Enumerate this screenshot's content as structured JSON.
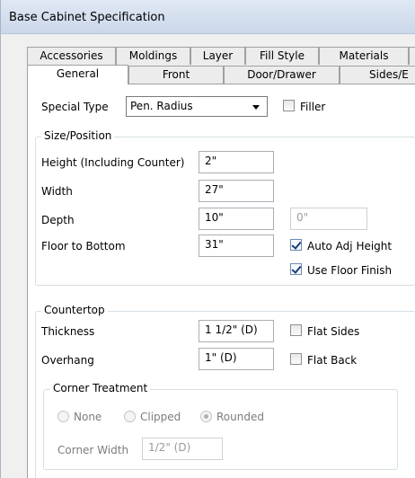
{
  "window": {
    "title": "Base Cabinet Specification"
  },
  "tabs_back": [
    "Accessories",
    "Moldings",
    "Layer",
    "Fill Style",
    "Materials"
  ],
  "tabs_front": [
    "General",
    "Front",
    "Door/Drawer",
    "Sides/E"
  ],
  "general": {
    "special_type_label": "Special Type",
    "special_type_value": "Pen. Radius",
    "filler_label": "Filler",
    "filler_checked": false
  },
  "size_position": {
    "group_title": "Size/Position",
    "height_label": "Height (Including Counter)",
    "height_value": "2\"",
    "width_label": "Width",
    "width_value": "27\"",
    "depth_label": "Depth",
    "depth_value": "10\"",
    "depth_secondary_value": "0\"",
    "floor_label": "Floor to Bottom",
    "floor_value": "31\"",
    "auto_adj_label": "Auto Adj Height",
    "auto_adj_checked": true,
    "use_floor_label": "Use Floor Finish",
    "use_floor_checked": true
  },
  "countertop": {
    "group_title": "Countertop",
    "thickness_label": "Thickness",
    "thickness_value": "1 1/2\" (D)",
    "flat_sides_label": "Flat Sides",
    "flat_sides_checked": false,
    "overhang_label": "Overhang",
    "overhang_value": "1\" (D)",
    "flat_back_label": "Flat Back",
    "flat_back_checked": false
  },
  "corner_treatment": {
    "group_title": "Corner Treatment",
    "options": [
      "None",
      "Clipped",
      "Rounded"
    ],
    "selected": "Rounded",
    "corner_width_label": "Corner Width",
    "corner_width_value": "1/2\" (D)"
  }
}
